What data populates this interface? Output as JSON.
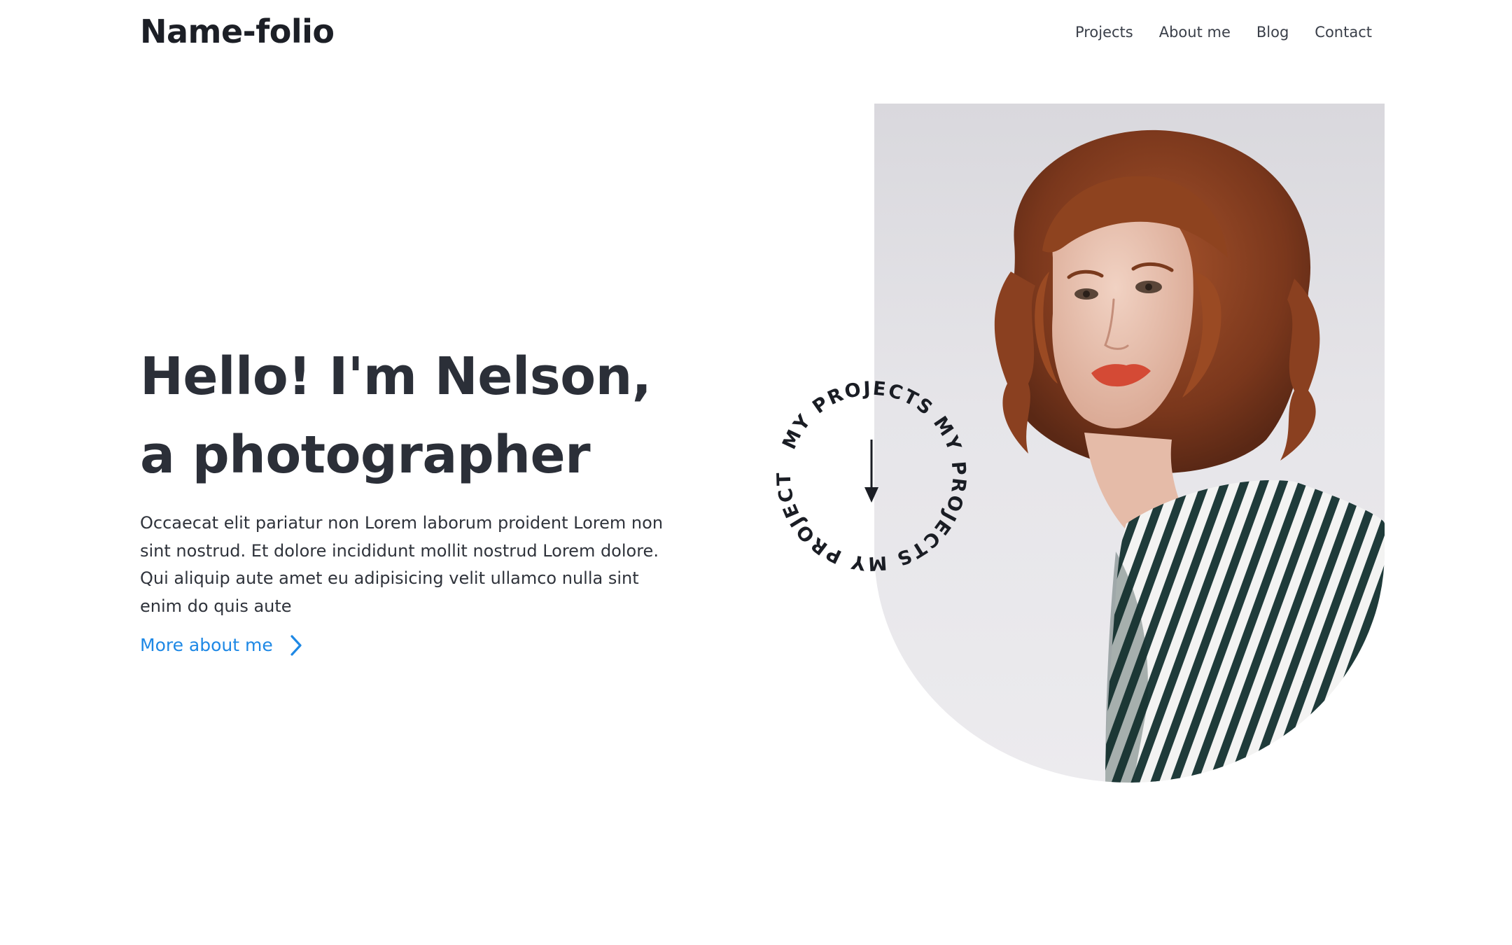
{
  "header": {
    "logo": "Name-folio",
    "nav": [
      {
        "label": "Projects"
      },
      {
        "label": "About me"
      },
      {
        "label": "Blog"
      },
      {
        "label": "Contact"
      }
    ]
  },
  "hero": {
    "title_line1": "Hello! I'm Nelson,",
    "title_line2": "a photographer",
    "description": "Occaecat elit pariatur non Lorem laborum proident Lorem non sint nostrud. Et dolore incididunt mollit nostrud Lorem dolore. Qui aliquip aute amet eu adipisicing velit ullamco nulla sint enim do quis aute",
    "link_label": "More about me",
    "link_icon": "chevron-right-icon"
  },
  "badge": {
    "segments": [
      "MY PROJECTS",
      "MY PROJECTS",
      "MY PROJECTS"
    ],
    "icon": "arrow-down-icon"
  },
  "colors": {
    "accent": "#1e88e5",
    "heading": "#2b2f38",
    "text": "#2f333b"
  }
}
